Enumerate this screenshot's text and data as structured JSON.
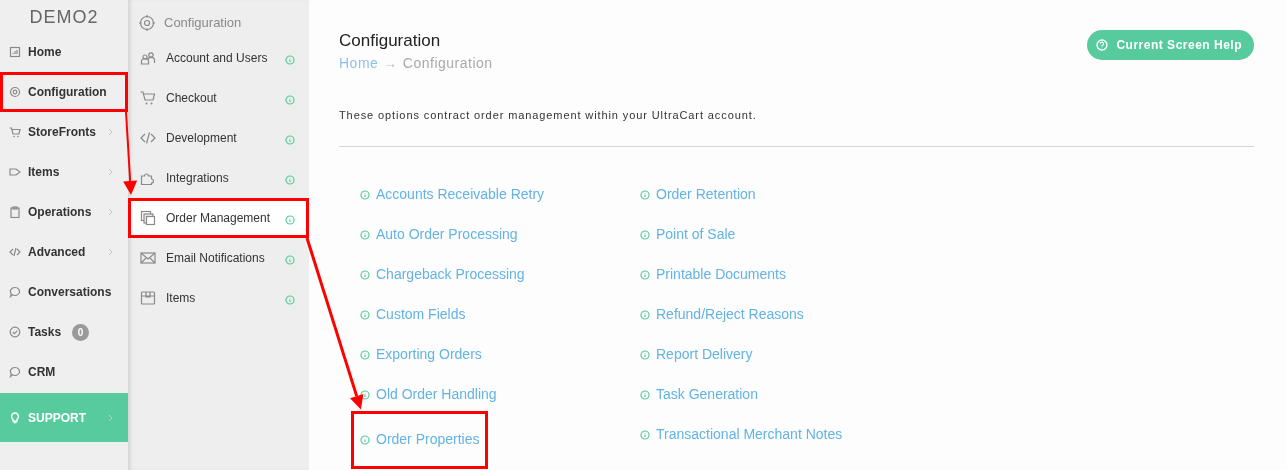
{
  "sidebar": {
    "brand": "DEMO2",
    "items": [
      {
        "label": "Home",
        "kind": "plain",
        "selected": false,
        "highlighted": false
      },
      {
        "label": "Configuration",
        "kind": "plain",
        "selected": false,
        "highlighted": true
      },
      {
        "label": "StoreFronts",
        "kind": "submenu",
        "selected": false,
        "highlighted": false
      },
      {
        "label": "Items",
        "kind": "submenu",
        "selected": false,
        "highlighted": false
      },
      {
        "label": "Operations",
        "kind": "submenu",
        "selected": false,
        "highlighted": false
      },
      {
        "label": "Advanced",
        "kind": "submenu",
        "selected": false,
        "highlighted": false
      },
      {
        "label": "Conversations",
        "kind": "plain",
        "selected": false,
        "highlighted": false
      },
      {
        "label": "Tasks",
        "kind": "badge",
        "badge": "0",
        "selected": false,
        "highlighted": false
      },
      {
        "label": "CRM",
        "kind": "plain",
        "selected": false,
        "highlighted": false
      },
      {
        "label": "SUPPORT",
        "kind": "submenu",
        "selected": true,
        "highlighted": false
      }
    ]
  },
  "submenu": {
    "title": "Configuration",
    "items": [
      {
        "label": "Account and Users",
        "selected": false,
        "highlighted": false
      },
      {
        "label": "Checkout",
        "selected": false,
        "highlighted": false
      },
      {
        "label": "Development",
        "selected": false,
        "highlighted": false
      },
      {
        "label": "Integrations",
        "selected": false,
        "highlighted": false
      },
      {
        "label": "Order Management",
        "selected": true,
        "highlighted": true
      },
      {
        "label": "Email Notifications",
        "selected": false,
        "highlighted": false
      },
      {
        "label": "Items",
        "selected": false,
        "highlighted": false
      }
    ]
  },
  "main": {
    "title": "Configuration",
    "breadcrumb": [
      "Home",
      "→",
      "Configuration"
    ],
    "help_button": "Current Screen Help",
    "description": "These options contract order management within your UltraCart account.",
    "links": [
      [
        {
          "label": "Accounts Receivable Retry",
          "highlighted": false
        },
        {
          "label": "Auto Order Processing",
          "highlighted": false
        },
        {
          "label": "Chargeback Processing",
          "highlighted": false
        },
        {
          "label": "Custom Fields",
          "highlighted": false
        },
        {
          "label": "Exporting Orders",
          "highlighted": false
        },
        {
          "label": "Old Order Handling",
          "highlighted": false
        },
        {
          "label": "Order Properties",
          "highlighted": true
        }
      ],
      [
        {
          "label": "Order Retention",
          "highlighted": false
        },
        {
          "label": "Point of Sale",
          "highlighted": false
        },
        {
          "label": "Printable Documents",
          "highlighted": false
        },
        {
          "label": "Refund/Reject Reasons",
          "highlighted": false
        },
        {
          "label": "Report Delivery",
          "highlighted": false
        },
        {
          "label": "Task Generation",
          "highlighted": false
        },
        {
          "label": "Transactional Merchant Notes",
          "highlighted": false
        }
      ]
    ]
  }
}
